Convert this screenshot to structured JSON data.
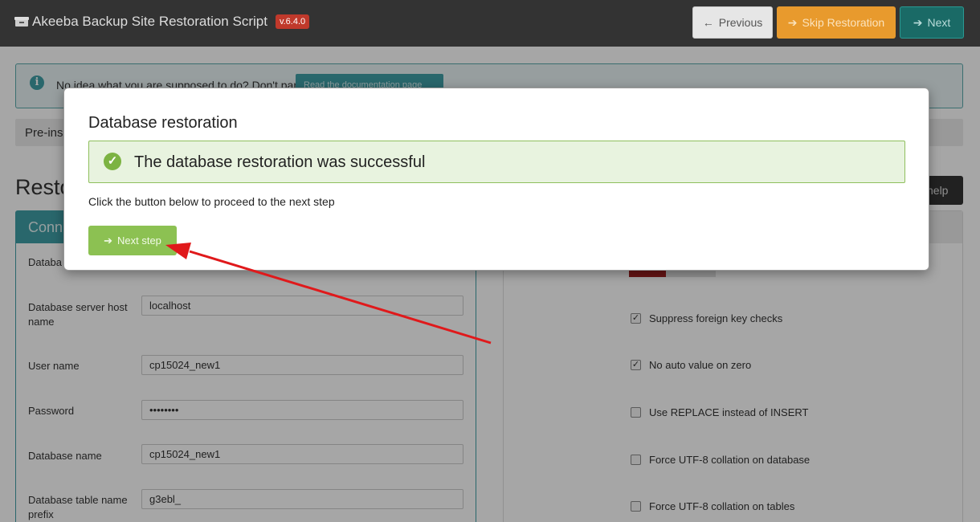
{
  "header": {
    "title": "Akeeba Backup Site Restoration Script",
    "version": "v.6.4.0",
    "previous_label": "Previous",
    "skip_label": "Skip Restoration",
    "next_label": "Next"
  },
  "help": {
    "text": "No idea what you are supposed to do? Don't panic!",
    "link_label": "Read the documentation page"
  },
  "steps": {
    "text": "Pre-ins"
  },
  "page": {
    "title": "Resto",
    "help_button": "help",
    "left_panel_title": "Conn"
  },
  "form": {
    "database_partial_label": "Databa",
    "fields": [
      {
        "label": "Database server host name",
        "value": "localhost"
      },
      {
        "label": "User name",
        "value": "cp15024_new1"
      },
      {
        "label": "Password",
        "value": "••••••••"
      },
      {
        "label": "Database name",
        "value": "cp15024_new1"
      },
      {
        "label": "Database table name prefix",
        "value": "g3ebl_"
      }
    ]
  },
  "options": [
    {
      "label": "Suppress foreign key checks",
      "checked": true
    },
    {
      "label": "No auto value on zero",
      "checked": true
    },
    {
      "label": "Use REPLACE instead of INSERT",
      "checked": false
    },
    {
      "label": "Force UTF-8 collation on database",
      "checked": false
    },
    {
      "label": "Force UTF-8 collation on tables",
      "checked": false
    }
  ],
  "modal": {
    "title": "Database restoration",
    "success_message": "The database restoration was successful",
    "instruction": "Click the button below to proceed to the next step",
    "next_step_label": "Next step"
  },
  "colors": {
    "header_bg": "#333333",
    "accent_teal": "#3f9fa6",
    "success_green": "#8cc152",
    "skip_orange": "#e89a2d",
    "annotation_red": "#e0191b"
  }
}
